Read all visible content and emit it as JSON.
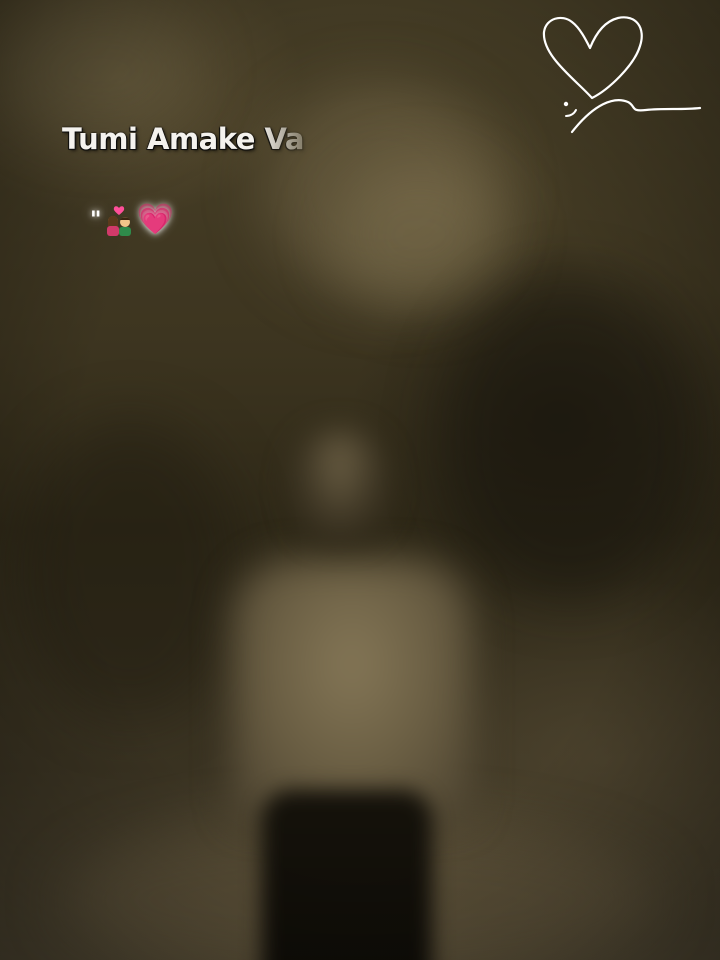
{
  "overlay": {
    "lyric_text": "Tumi Amake Va",
    "quote_mark": "\"",
    "emoji_couple": "couple-with-heart",
    "emoji_heart": "💗"
  },
  "colors": {
    "background_tone": "#3d3520",
    "text": "#f4f2ee",
    "heart_pink": "#ff3f8e",
    "logo_stroke": "#ffffff"
  },
  "icons": {
    "corner_logo": "heart-line-icon"
  }
}
